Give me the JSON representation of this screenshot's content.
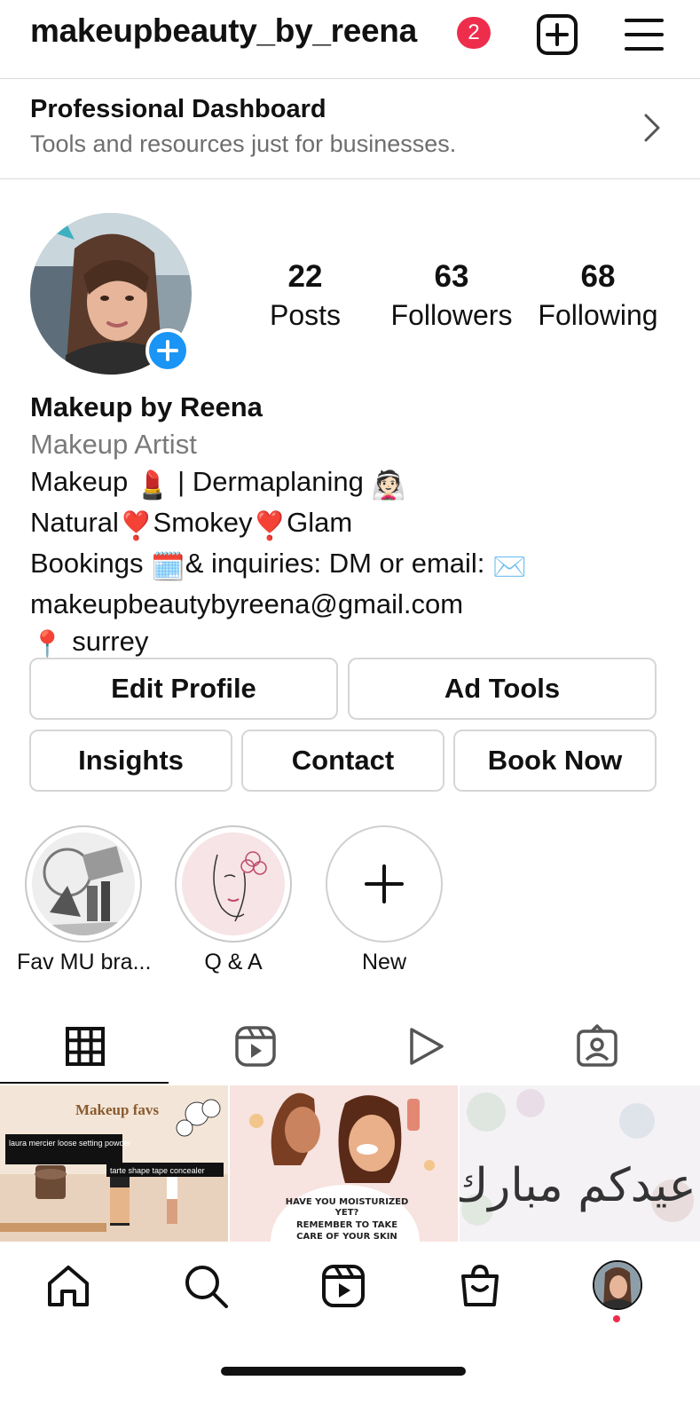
{
  "header": {
    "username": "makeupbeauty_by_reena",
    "notification_count": "2",
    "icons": [
      "plus-square-icon",
      "menu-icon"
    ]
  },
  "dashboard": {
    "title": "Professional Dashboard",
    "subtitle": "Tools and resources just for businesses."
  },
  "stats": [
    {
      "value": "22",
      "label": "Posts"
    },
    {
      "value": "63",
      "label": "Followers"
    },
    {
      "value": "68",
      "label": "Following"
    }
  ],
  "bio": {
    "name": "Makeup by Reena",
    "category": "Makeup Artist",
    "line1_a": "Makeup",
    "line1_b": "| Dermaplaning",
    "line2_a": "Natural",
    "line2_b": "Smokey",
    "line2_c": "Glam",
    "line3_a": "Bookings",
    "line3_b": "& inquiries: DM or email:",
    "email": "makeupbeautybyreena@gmail.com",
    "location": "surrey",
    "emoji": {
      "lipstick": "💄",
      "bride": "👰🏻",
      "exclamation": "❣️",
      "calendar": "🗓️",
      "envelope": "✉️",
      "pin": "📍"
    }
  },
  "buttons": {
    "edit_profile": "Edit Profile",
    "ad_tools": "Ad Tools",
    "insights": "Insights",
    "contact": "Contact",
    "book_now": "Book Now"
  },
  "highlights": [
    {
      "label": "Fav MU bra..."
    },
    {
      "label": "Q & A"
    },
    {
      "label": "New"
    }
  ],
  "tabs": [
    "grid-icon",
    "reels-icon",
    "video-play-icon",
    "tagged-icon"
  ],
  "posts": [
    {
      "title": "Makeup favs",
      "tag1": "laura mercier  loose setting powder",
      "tag2": "tarte shape tape concealer"
    },
    {
      "text1": "HAVE YOU MOISTURIZED",
      "text2": "YET?",
      "text3": "REMEMBER TO TAKE",
      "text4": "CARE OF YOUR SKIN"
    },
    {
      "text": "عيدكم مبارك"
    }
  ],
  "bottom_nav": [
    "home-icon",
    "search-icon",
    "reels-icon",
    "shop-icon",
    "profile-avatar"
  ],
  "colors": {
    "badge": "#ee2d4c",
    "add_story": "#1a95f5",
    "secondary_text": "#6e6e6e",
    "border": "#dbdbdb"
  }
}
